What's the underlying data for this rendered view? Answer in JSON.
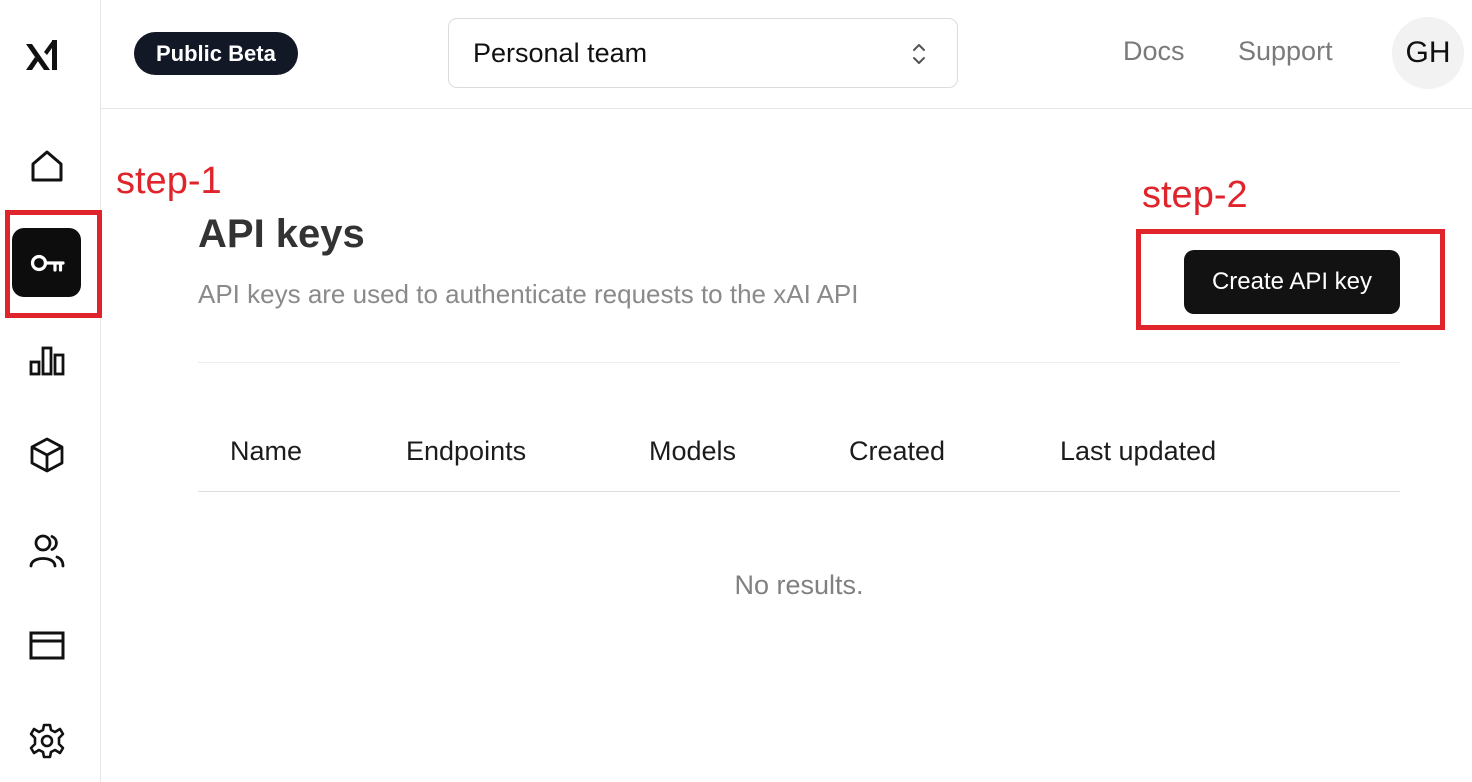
{
  "sidebar": {
    "logo": "xAI",
    "items": [
      {
        "name": "home",
        "icon": "home-icon"
      },
      {
        "name": "api-keys",
        "icon": "key-icon",
        "active": true
      },
      {
        "name": "usage",
        "icon": "bar-chart-icon"
      },
      {
        "name": "models",
        "icon": "cube-icon"
      },
      {
        "name": "team",
        "icon": "users-icon"
      },
      {
        "name": "billing",
        "icon": "credit-card-icon"
      },
      {
        "name": "settings",
        "icon": "gear-icon"
      }
    ]
  },
  "header": {
    "badge": "Public Beta",
    "team_select": {
      "value": "Personal team",
      "icon": "chevron-up-down-icon"
    },
    "links": {
      "docs": "Docs",
      "support": "Support"
    },
    "avatar": "GH"
  },
  "annotations": {
    "step1": "step-1",
    "step2": "step-2",
    "color": "#e0242c"
  },
  "main": {
    "title": "API keys",
    "subtitle": "API keys are used to authenticate requests to the xAI API",
    "create_button": "Create API key",
    "table": {
      "columns": [
        "Name",
        "Endpoints",
        "Models",
        "Created",
        "Last updated"
      ],
      "empty_message": "No results."
    }
  }
}
